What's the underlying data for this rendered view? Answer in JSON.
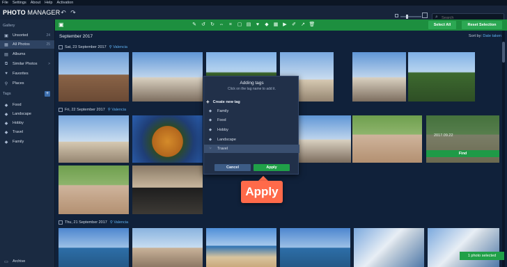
{
  "menu": [
    "File",
    "Settings",
    "About",
    "Help",
    "Activation"
  ],
  "brand": {
    "bold": "PHOTO",
    "light": "MANAGER"
  },
  "search": {
    "placeholder": "Search"
  },
  "sidebar": {
    "gallery_label": "Gallery",
    "items": [
      {
        "label": "Unsorted",
        "count": "24"
      },
      {
        "label": "All Photos",
        "count": "25"
      },
      {
        "label": "Albums",
        "count": ""
      },
      {
        "label": "Similar Photos",
        "count": ">"
      },
      {
        "label": "Favorites",
        "count": ""
      },
      {
        "label": "Places",
        "count": ""
      }
    ],
    "tags_label": "Tags",
    "tags": [
      "Food",
      "Landscape",
      "Hobby",
      "Travel",
      "Family"
    ],
    "archive": "Archive"
  },
  "toolbar": {
    "select_all": "Select All",
    "reset_selection": "Reset Selection"
  },
  "main": {
    "month": "September 2017",
    "sort_label": "Sort by:",
    "sort_value": "Date taken",
    "groups": [
      {
        "date": "Sat, 23 September 2017",
        "location": "Valencia"
      },
      {
        "date": "Fri, 22 September 2017",
        "location": "Valencia"
      },
      {
        "date": "Thu, 21 September 2017",
        "location": "Valencia"
      }
    ],
    "find_label": "Find",
    "photo_caption": "2017.09.22"
  },
  "dialog": {
    "title": "Adding tags",
    "subtitle": "Click on the tag name to add it.",
    "create_label": "Create new tag",
    "tags": [
      "Family",
      "Food",
      "Hobby",
      "Landscape",
      "Travel"
    ],
    "cancel": "Cancel",
    "apply": "Apply"
  },
  "callout": "Apply",
  "toast": "1 photo selected"
}
